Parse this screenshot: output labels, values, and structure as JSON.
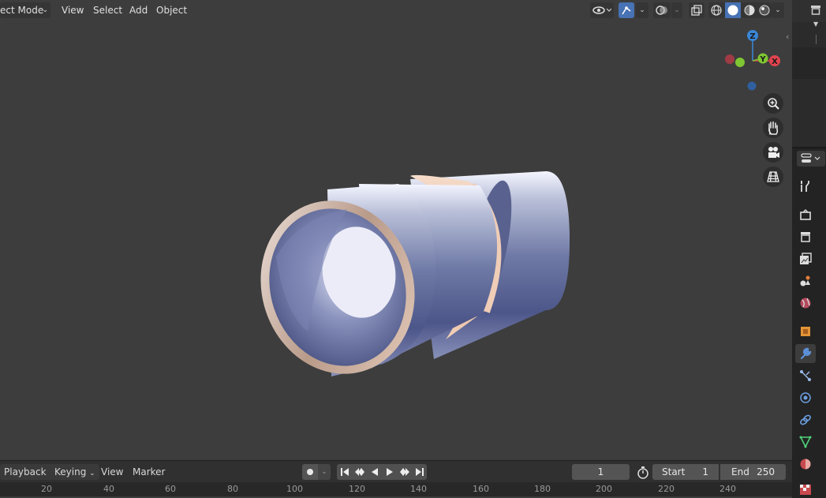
{
  "viewport_header": {
    "mode_label": "ect Mode",
    "menus": [
      "View",
      "Select",
      "Add",
      "Object"
    ]
  },
  "gizmo": {
    "z_label": "Z",
    "y_label": "Y",
    "x_label": "X",
    "colors": {
      "x": "#e2444f",
      "y": "#7fc632",
      "z": "#3a87d7"
    }
  },
  "timeline": {
    "menus": [
      "Playback",
      "Keying",
      "View",
      "Marker"
    ],
    "current_frame": "1",
    "start_label": "Start",
    "start_value": "1",
    "end_label": "End",
    "end_value": "250",
    "ruler": [
      "20",
      "40",
      "60",
      "80",
      "100",
      "120",
      "140",
      "160",
      "180",
      "200",
      "220",
      "240"
    ]
  },
  "properties_tabs": [
    "tool-icon",
    "render-icon",
    "output-icon",
    "view-layer-icon",
    "scene-icon",
    "world-icon",
    "object-icon",
    "modifier-icon",
    "particles-icon",
    "physics-icon",
    "constraints-icon",
    "data-icon",
    "material-icon",
    "texture-icon"
  ],
  "colors": {
    "accent": "#4772b3",
    "background": "#3d3d3d"
  }
}
